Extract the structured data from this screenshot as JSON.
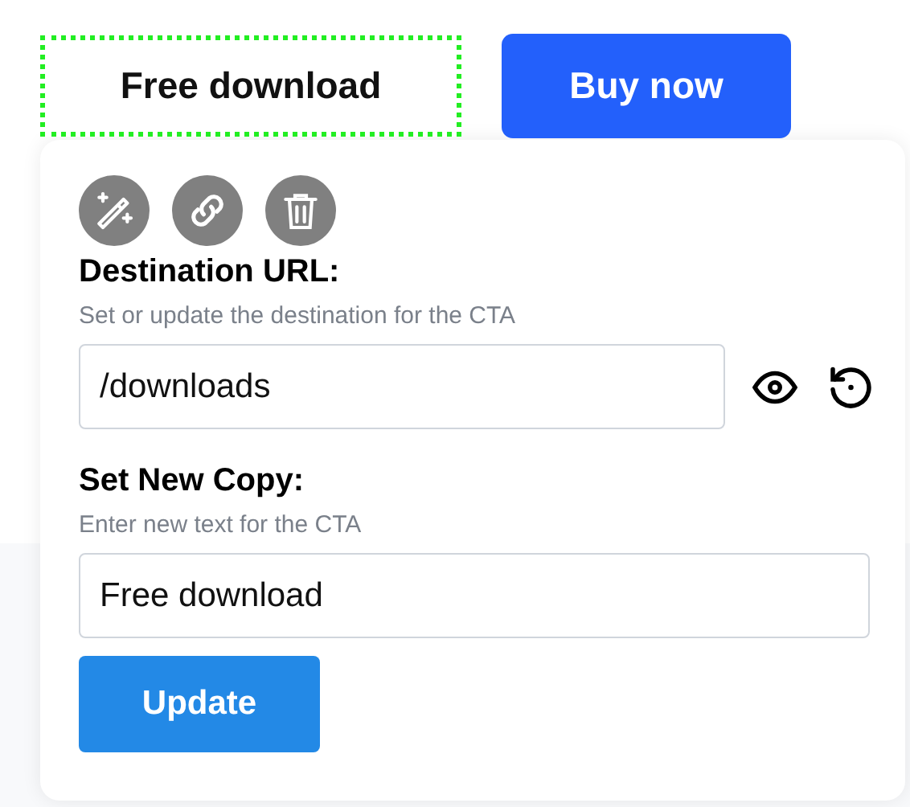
{
  "cta_buttons": [
    {
      "label": "Free download",
      "kind": "outline",
      "selected": true
    },
    {
      "label": "Buy now",
      "kind": "primary",
      "selected": false
    }
  ],
  "editor": {
    "url_section": {
      "label": "Destination URL:",
      "help": "Set or update the destination for the CTA",
      "value": "/downloads"
    },
    "copy_section": {
      "label": "Set New Copy:",
      "help": "Enter new text for the CTA",
      "value": "Free download"
    },
    "submit": "Update"
  }
}
